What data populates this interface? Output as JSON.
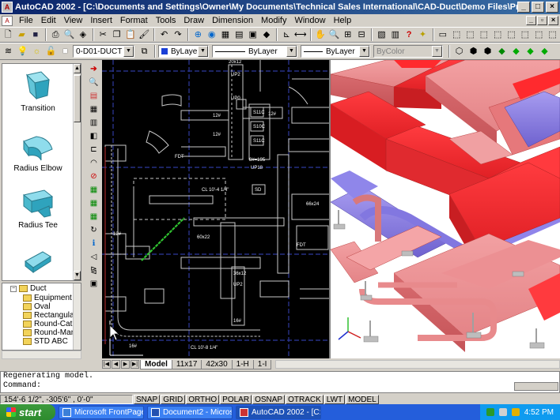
{
  "window": {
    "title": "AutoCAD 2002 - [C:\\Documents and Settings\\Owner\\My Documents\\Technical Sales International\\CAD-Duct\\Demo Files\\Projects\\4M4_1H-I-2.dwg]"
  },
  "menu": [
    "File",
    "Edit",
    "View",
    "Insert",
    "Format",
    "Tools",
    "Draw",
    "Dimension",
    "Modify",
    "Window",
    "Help"
  ],
  "layer_bar": {
    "layer": "0-D01-DUCT",
    "color": "ByLayer",
    "linetype": "ByLayer",
    "lineweight": "ByLayer",
    "plotstyle": "ByColor"
  },
  "palette": [
    "Transition",
    "Radius Elbow",
    "Radius Tee"
  ],
  "tree": {
    "root": "Duct",
    "items": [
      "Equipment",
      "Oval",
      "Rectangula",
      "Round-Cat",
      "Round-Man",
      "STD ABC"
    ]
  },
  "drawing_labels": [
    "20x12",
    "UP2",
    "UP0",
    "12#",
    "12#",
    "12#",
    "S11C",
    "S10C",
    "S11C",
    "FDT",
    "8#=195",
    "UP18",
    "CL 10'-4 1/4\"",
    "SD",
    "60x22",
    "12#",
    "FDT",
    "66x24",
    "36x12",
    "UP2",
    "16#",
    "16#",
    "CL 10'-8 1/4\""
  ],
  "layout_tabs": [
    "Model",
    "11x17",
    "42x30",
    "1-H",
    "1-I"
  ],
  "active_tab": "Model",
  "command": {
    "history": "Regenerating model.",
    "prompt": "Command:"
  },
  "status": {
    "coords": "154'-6 1/2\",  -305'6\"  , 0'-0\"",
    "buttons": [
      "SNAP",
      "GRID",
      "ORTHO",
      "POLAR",
      "OSNAP",
      "OTRACK",
      "LWT",
      "MODEL"
    ]
  },
  "taskbar": {
    "start": "start",
    "tasks": [
      "Microsoft FrontPage - ...",
      "Document2 - Microsof...",
      "AutoCAD 2002 - [C:\\..."
    ],
    "active_task": 2,
    "time": "4:52 PM"
  },
  "colors": {
    "title_active": "#0a246a",
    "duct_red": "#e8333b",
    "duct_pink": "#e88a8c",
    "duct_purple": "#8c7fe0",
    "taskbar": "#245edb"
  }
}
